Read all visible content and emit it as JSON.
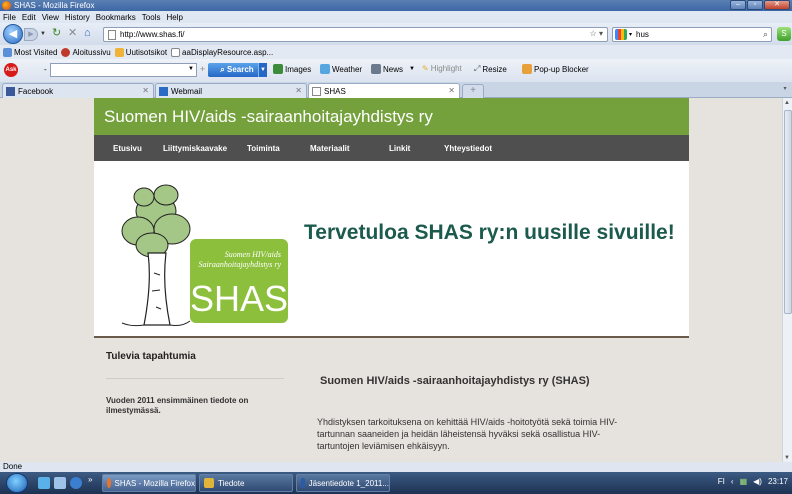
{
  "window": {
    "title": "SHAS - Mozilla Firefox"
  },
  "menu": [
    "File",
    "Edit",
    "View",
    "History",
    "Bookmarks",
    "Tools",
    "Help"
  ],
  "menu_underline": [
    "F",
    "E",
    "V",
    "s",
    "B",
    "T",
    "H"
  ],
  "nav": {
    "url": "http://www.shas.fi/",
    "search_value": "hus"
  },
  "bookmarks": [
    "Most Visited",
    "Aloitussivu",
    "Uutisotsikot",
    "aaDisplayResource.asp..."
  ],
  "ask_toolbar": {
    "logo": "Ask",
    "search_label": "Search",
    "items": [
      "Images",
      "Weather",
      "News",
      "Highlight",
      "Resize",
      "Pop-up Blocker"
    ]
  },
  "tabs": [
    {
      "label": "Facebook",
      "active": false
    },
    {
      "label": "Webmail",
      "active": false
    },
    {
      "label": "SHAS",
      "active": true
    }
  ],
  "site": {
    "header_title": "Suomen HIV/aids -sairaanhoitajayhdistys ry",
    "nav": [
      "Etusivu",
      "Liittymiskaavake",
      "Toiminta",
      "Materiaalit",
      "Linkit",
      "Yhteystiedot"
    ],
    "logo_line1": "Suomen HIV/aids",
    "logo_line2": "Sairaanhoitajayhdistys ry",
    "logo_big": "SHAS",
    "welcome": "Tervetuloa SHAS ry:n uusille sivuille!",
    "sidebar_title": "Tulevia tapahtumia",
    "sidebar_text": "Vuoden 2011 ensimmäinen tiedote on ilmestymässä.",
    "main_title": "Suomen HIV/aids -sairaanhoitajayhdistys ry (SHAS)",
    "main_text": "Yhdistyksen tarkoituksena on kehittää HIV/aids -hoitotyötä sekä toimia HIV-tartunnan saaneiden ja heidän läheistensä hyväksi sekä osallistua HIV-tartuntojen leviämisen ehkäisyyn."
  },
  "status": "Done",
  "taskbar": {
    "items": [
      "SHAS - Mozilla Firefox",
      "Tiedote",
      "Jäsentiedote 1_2011..."
    ],
    "lang": "FI",
    "time": "23:17"
  }
}
